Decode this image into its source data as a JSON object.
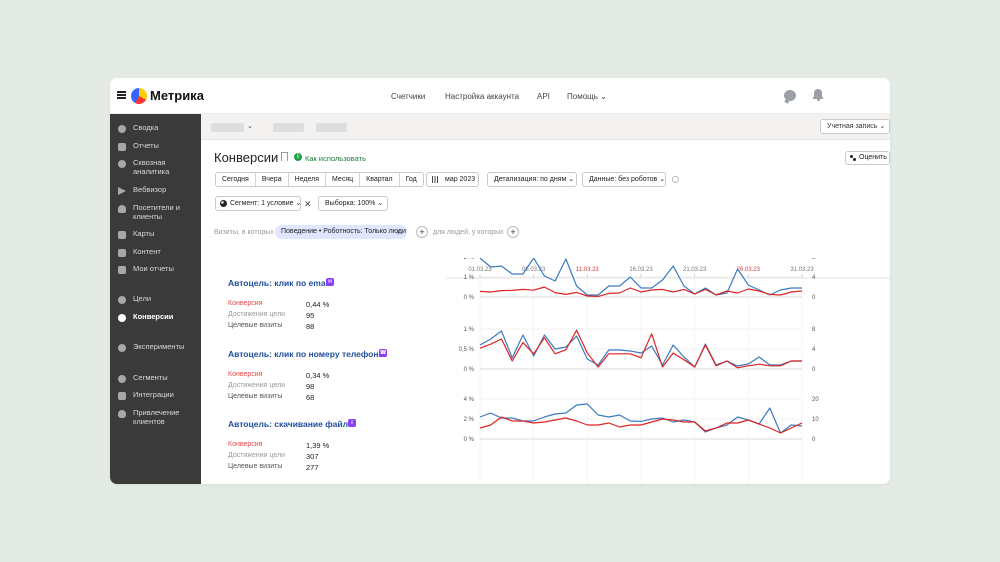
{
  "app": {
    "logo_text": "Метрика",
    "nav": [
      "Счетчики",
      "Настройка аккаунта",
      "API",
      "Помощь ⌄"
    ]
  },
  "sidebar": {
    "items": [
      {
        "label": "Сводка",
        "icon": "gauge-icon"
      },
      {
        "label": "Отчеты",
        "icon": "bar-chart-icon"
      },
      {
        "label": "Сквозная аналитика",
        "icon": "gear-icon"
      },
      {
        "label": "Вебвизор",
        "icon": "play-icon"
      },
      {
        "label": "Посетители и клиенты",
        "icon": "person-icon"
      },
      {
        "label": "Карты",
        "icon": "map-icon"
      },
      {
        "label": "Контент",
        "icon": "content-icon"
      },
      {
        "label": "Мои отчеты",
        "icon": "monitor-icon"
      },
      {
        "label": "Цели",
        "icon": "target-icon"
      },
      {
        "label": "Конверсии",
        "icon": "percent-icon",
        "active": true
      },
      {
        "label": "Эксперименты",
        "icon": "flask-icon"
      },
      {
        "label": "Сегменты",
        "icon": "pie-icon"
      },
      {
        "label": "Интеграции",
        "icon": "puzzle-icon"
      },
      {
        "label": "Привлечение клиентов",
        "icon": "flame-icon"
      }
    ]
  },
  "account_button": "Учетная запись ⌄",
  "page": {
    "title": "Конверсии",
    "help_link": "Как использовать",
    "rate_button": "Оценить"
  },
  "period_buttons": [
    "Сегодня",
    "Вчера",
    "Неделя",
    "Месяц",
    "Квартал",
    "Год"
  ],
  "date_button": "мар 2023",
  "detail_button": "Детализация: по дням ⌄",
  "data_button": "Данные: без роботов ⌄",
  "segment_button": "Сегмент: 1 условие ⌄",
  "sample_button": "Выборка: 100% ⌄",
  "segment_close": "✕",
  "visits_label": "Визиты, в которых",
  "filter_chip": "Поведение • Роботность: Только люди",
  "people_label": "для людей, у которых",
  "plus_symbol": "+",
  "chip_close": "✕",
  "metric_labels": {
    "conversion": "Конверсия",
    "achievements": "Достижения цели",
    "visits": "Целевые визиты"
  },
  "goals": [
    {
      "title": "Автоцель: клик по email",
      "badge": "✉",
      "conversion": "0,44 %",
      "achievements": "95",
      "visits": "88"
    },
    {
      "title": "Автоцель: клик по номеру телефона",
      "badge": "☎",
      "conversion": "0,34 %",
      "achievements": "98",
      "visits": "68"
    },
    {
      "title": "Автоцель: скачивание файла",
      "badge": "⇩",
      "conversion": "1,39 %",
      "achievements": "307",
      "visits": "277"
    }
  ],
  "colors": {
    "blue": "#3a7bbf",
    "red": "#e02424",
    "accent_link": "#1f4e9a",
    "sidebar_bg": "#3a3a3a"
  },
  "chart_data": [
    {
      "type": "line",
      "title": "Автоцель: клик по email",
      "x_ticks": [
        {
          "label": "01.03.23",
          "weekend": false
        },
        {
          "label": "06.03.23",
          "weekend": false
        },
        {
          "label": "11.03.23",
          "weekend": true
        },
        {
          "label": "16.03.23",
          "weekend": false
        },
        {
          "label": "21.03.23",
          "weekend": false
        },
        {
          "label": "26.03.23",
          "weekend": true
        },
        {
          "label": "31.03.23",
          "weekend": false
        }
      ],
      "left_axis": {
        "ticks": [
          "2 %",
          "1 %",
          "0 %"
        ],
        "range": [
          0,
          2
        ]
      },
      "right_axis": {
        "ticks": [
          "8",
          "4",
          "0"
        ],
        "range": [
          0,
          8
        ]
      },
      "series": [
        {
          "name": "",
          "axis": "right",
          "color": "#3a7bbf",
          "values": [
            7.8,
            6,
            6.2,
            4.6,
            4.6,
            7.8,
            4.2,
            3.2,
            7.6,
            2.2,
            0.4,
            0.4,
            2.2,
            2.2,
            4,
            1.8,
            1.8,
            3.4,
            6.2,
            2.2,
            0.6,
            1.8,
            0.4,
            0.8,
            5.6,
            2.4,
            1.4,
            0.4,
            1.4,
            1.8,
            1.8
          ]
        },
        {
          "name": "",
          "axis": "left",
          "color": "#e02424",
          "values": [
            0.28,
            0.25,
            0.32,
            0.33,
            0.38,
            0.34,
            0.5,
            0.22,
            0.13,
            0.23,
            0.05,
            0.03,
            0.18,
            0.2,
            0.45,
            0.25,
            0.35,
            0.38,
            0.25,
            0.38,
            0.15,
            0.38,
            0.1,
            0.3,
            0.2,
            0.4,
            0.3,
            0.13,
            0.1,
            0.25,
            0.3
          ]
        }
      ]
    },
    {
      "type": "line",
      "title": "Автоцель: клик по номеру телефона",
      "left_axis": {
        "ticks": [
          "1 %",
          "0,5 %",
          "0 %"
        ],
        "range": [
          0,
          1
        ]
      },
      "right_axis": {
        "ticks": [
          "8",
          "4",
          "0"
        ],
        "range": [
          0,
          8
        ]
      },
      "series": [
        {
          "name": "",
          "axis": "right",
          "color": "#3a7bbf",
          "values": [
            4.8,
            6,
            7.6,
            2.2,
            6.8,
            2.6,
            6.8,
            4,
            4.4,
            6.6,
            2,
            0.8,
            3.8,
            3.8,
            3.6,
            3.2,
            4.6,
            0.8,
            4.8,
            2.4,
            0.4,
            5,
            0.8,
            1.6,
            0.6,
            1,
            2.4,
            0.8,
            0.8,
            1.6,
            1.6
          ]
        },
        {
          "name": "",
          "axis": "left",
          "color": "#e02424",
          "values": [
            0.52,
            0.62,
            0.75,
            0.2,
            0.66,
            0.38,
            0.78,
            0.38,
            0.48,
            0.97,
            0.4,
            0.05,
            0.38,
            0.38,
            0.38,
            0.28,
            0.88,
            0.05,
            0.4,
            0.23,
            0.05,
            0.6,
            0.08,
            0.2,
            0.03,
            0.08,
            0.12,
            0.08,
            0.08,
            0.2,
            0.2
          ]
        }
      ]
    },
    {
      "type": "line",
      "title": "Автоцель: скачивание файла",
      "left_axis": {
        "ticks": [
          "4 %",
          "2 %",
          "0 %"
        ],
        "range": [
          0,
          4
        ]
      },
      "right_axis": {
        "ticks": [
          "20",
          "10",
          "0"
        ],
        "range": [
          0,
          20
        ]
      },
      "series": [
        {
          "name": "",
          "axis": "right",
          "color": "#3a7bbf",
          "values": [
            11,
            13,
            10.5,
            10.5,
            9,
            9,
            11,
            12.5,
            13,
            17,
            17.5,
            12,
            11,
            12,
            9,
            8.8,
            10,
            10.5,
            8.5,
            9.5,
            8.5,
            3.5,
            5.5,
            7,
            11,
            9.5,
            7.5,
            15.5,
            3,
            7,
            6.5
          ]
        },
        {
          "name": "",
          "axis": "left",
          "color": "#e02424",
          "values": [
            1.1,
            1.4,
            2.2,
            1.8,
            1.8,
            1.6,
            1.7,
            1.9,
            2.1,
            1.8,
            1.4,
            1.4,
            1.6,
            1.2,
            1.4,
            1.4,
            1.7,
            2.0,
            1.9,
            1.7,
            1.7,
            0.8,
            1.1,
            1.6,
            1.6,
            1.9,
            1.5,
            1.1,
            0.6,
            1.1,
            1.6
          ]
        }
      ]
    }
  ]
}
